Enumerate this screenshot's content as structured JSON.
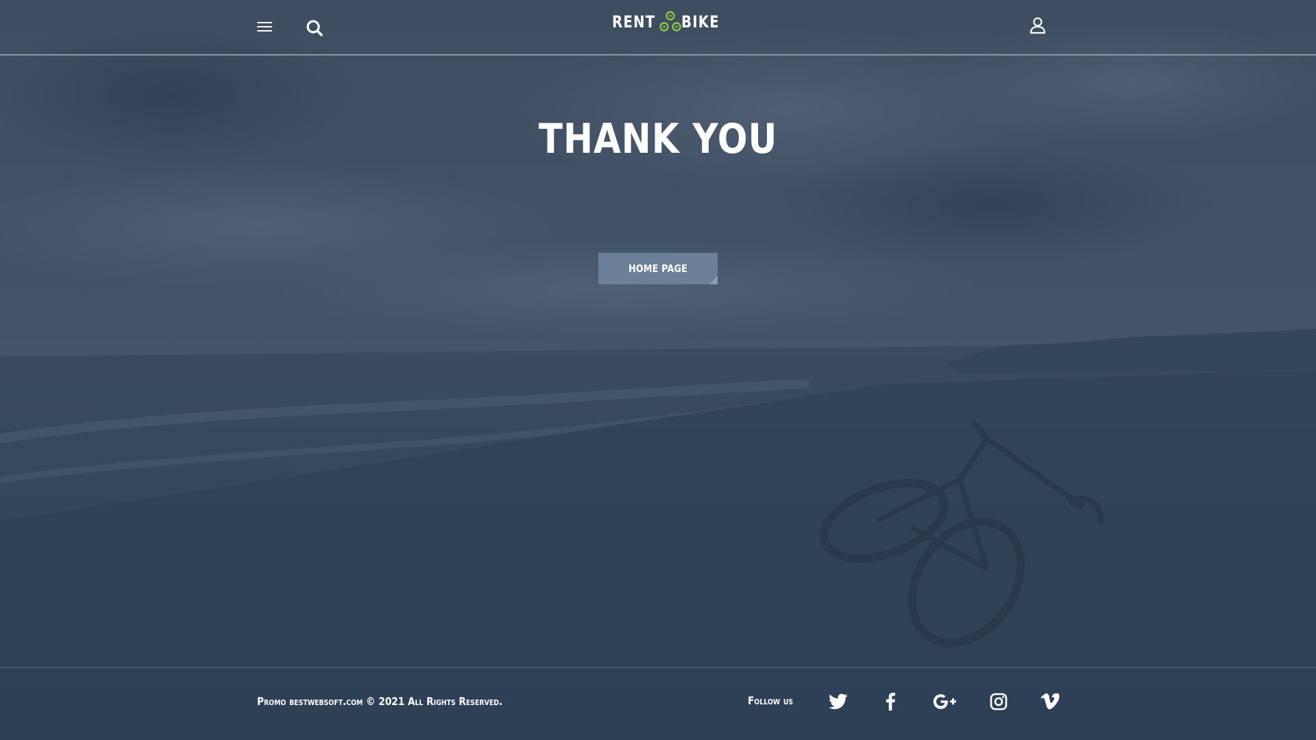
{
  "header": {
    "logo_left": "RENT",
    "logo_right": "BIKE"
  },
  "main": {
    "title": "THANK YOU",
    "home_button_label": "HOME PAGE"
  },
  "footer": {
    "copyright": "Promo bestwebsoft.com © 2021 All Rights Reserved.",
    "follow_label": "Follow us",
    "social_icons": [
      "twitter-icon",
      "facebook-icon",
      "google-plus-icon",
      "instagram-icon",
      "vimeo-icon"
    ]
  },
  "colors": {
    "overlay": "#3a4a5d",
    "button": "#6b7f98",
    "logo_accent": "#8cc63f",
    "text": "#ffffff"
  }
}
